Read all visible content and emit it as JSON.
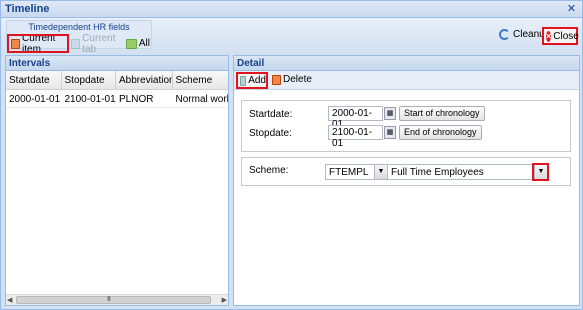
{
  "window": {
    "title": "Timeline"
  },
  "toolbar": {
    "group_title": "Timedependent HR fields",
    "current_item": "Current item",
    "current_tab": "Current tab",
    "all": "All",
    "cleanup": "Cleanup",
    "close": "Close"
  },
  "intervals": {
    "title": "Intervals",
    "columns": [
      "Startdate",
      "Stopdate",
      "Abbreviation",
      "Scheme"
    ],
    "rows": [
      {
        "startdate": "2000-01-01",
        "stopdate": "2100-01-01",
        "abbreviation": "PLNOR",
        "scheme": "Normal workwe"
      }
    ],
    "scroll_grip": "III"
  },
  "detail": {
    "title": "Detail",
    "add": "Add",
    "delete": "Delete",
    "startdate_label": "Startdate:",
    "startdate_value": "2000-01-01",
    "start_btn": "Start of chronology",
    "stopdate_label": "Stopdate:",
    "stopdate_value": "2100-01-01",
    "end_btn": "End of chronology",
    "scheme_label": "Scheme:",
    "scheme_code": "FTEMPL",
    "scheme_name": "Full Time Employees"
  }
}
